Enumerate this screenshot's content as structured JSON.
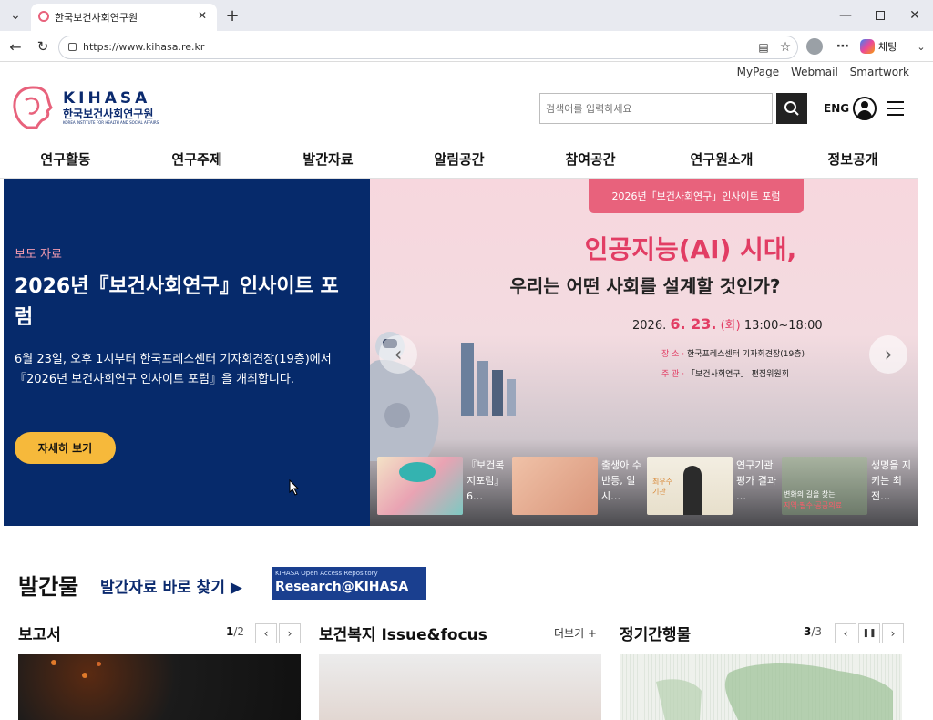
{
  "browser": {
    "tab_title": "한국보건사회연구원",
    "url": "https://www.kihasa.re.kr",
    "copilot_label": "채팅"
  },
  "header": {
    "util_links": [
      "MyPage",
      "Webmail",
      "Smartwork"
    ],
    "logo_en": "KIHASA",
    "logo_kr": "한국보건사회연구원",
    "logo_sub": "KOREA INSTITUTE FOR HEALTH AND SOCIAL AFFAIRS",
    "search_placeholder": "검색어를 입력하세요",
    "lang_label": "ENG"
  },
  "gnb": [
    "연구활동",
    "연구주제",
    "발간자료",
    "알림공간",
    "참여공간",
    "연구원소개",
    "정보공개"
  ],
  "hero": {
    "category": "보도 자료",
    "title": "2026년『보건사회연구』인사이트 포럼",
    "desc": "6월 23일, 오후 1시부터 한국프레스센터 기자회견장(19층)에서『2026년 보건사회연구 인사이트 포럼』을 개최합니다.",
    "more_button": "자세히 보기",
    "banner_tag": "2026년「보건사회연구」인사이트 포럼",
    "banner_headline": "인공지능(AI) 시대,",
    "banner_sub": "우리는 어떤 사회를 설계할 것인가?",
    "banner_date_prefix": "2026.",
    "banner_date_highlight": "6. 23.",
    "banner_day": "(화)",
    "banner_time": "13:00~18:00",
    "venue_label": "장 소 ·",
    "venue_value": "한국프레스센터 기자회견장(19층)",
    "host_label": "주 관 ·",
    "host_value": "「보건사회연구」 편집위원회",
    "thumbs": [
      {
        "caption": "『보건복지포럼』6…"
      },
      {
        "caption": "출생아 수 반등, 일시…"
      },
      {
        "caption": "연구기관 평가 결과 …"
      },
      {
        "caption": "생명을 지키는 최전…"
      }
    ],
    "thumb3_overlay": "최우수 기관",
    "thumb4_overlay_1": "변화의 길을 찾는",
    "thumb4_overlay_2": "지역·필수·공공의료"
  },
  "publications": {
    "title": "발간물",
    "shortcut": "발간자료 바로 찾기 ▶",
    "repo_small": "KIHASA Open Access Repository",
    "repo_big": "Research@KIHASA",
    "report": {
      "title": "보고서",
      "page_current": "1",
      "page_total": "2"
    },
    "issue": {
      "title": "보건복지 Issue&focus",
      "more": "더보기 +"
    },
    "periodical": {
      "title": "정기간행물",
      "page_current": "3",
      "page_total": "3"
    }
  },
  "colors": {
    "navy": "#062a6b",
    "accent_yellow": "#f6b93b",
    "pink": "#e8627c"
  }
}
